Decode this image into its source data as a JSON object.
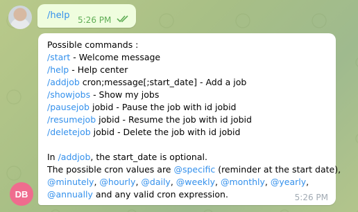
{
  "outgoing": {
    "text": "/help",
    "time": "5:26 PM",
    "status_icon": "double-check-icon"
  },
  "incoming": {
    "sender_initials": "DB",
    "time": "5:26 PM",
    "heading": "Possible commands :",
    "commands": [
      {
        "cmd": "/start",
        "desc": " - Welcome message"
      },
      {
        "cmd": "/help",
        "desc": " - Help center"
      },
      {
        "cmd": "/addjob",
        "desc": " cron;message[;start_date] - Add a job"
      },
      {
        "cmd": "/showjobs",
        "desc": " - Show my jobs"
      },
      {
        "cmd": "/pausejob",
        "desc": " jobid - Pause the job with id jobid"
      },
      {
        "cmd": "/resumejob",
        "desc": " jobid - Resume the job with id jobid"
      },
      {
        "cmd": "/deletejob",
        "desc": " jobid - Delete the job with id jobid"
      }
    ],
    "note": {
      "prefix": "In ",
      "cmd": "/addjob",
      "suffix": ", the start_date is optional."
    },
    "cron": {
      "prefix": "The possible cron values are ",
      "specific": "@specific",
      "specific_suffix": " (reminder at the start date),",
      "line2": [
        "@minutely",
        "@hourly",
        "@daily",
        "@weekly",
        "@monthly",
        "@yearly"
      ],
      "sep": ", ",
      "line2_end": ",",
      "annually": "@annually",
      "end": " and any valid cron expression."
    }
  }
}
